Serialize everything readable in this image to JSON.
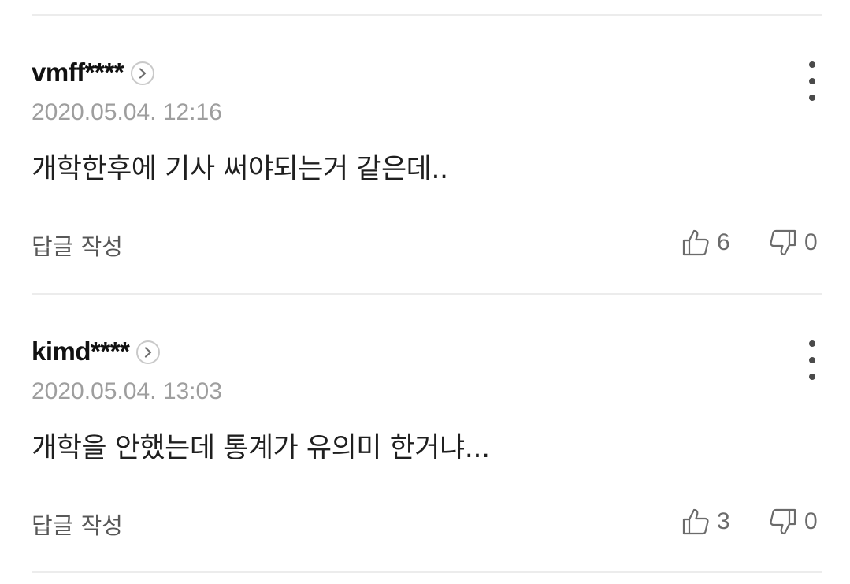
{
  "comments": [
    {
      "author": "vmff****",
      "timestamp": "2020.05.04. 12:16",
      "body": "개학한후에 기사 써야되는거 같은데..",
      "reply_label": "답글 작성",
      "likes": "6",
      "dislikes": "0"
    },
    {
      "author": "kimd****",
      "timestamp": "2020.05.04. 13:03",
      "body": "개학을 안했는데 통계가 유의미 한거냐...",
      "reply_label": "답글 작성",
      "likes": "3",
      "dislikes": "0"
    }
  ],
  "icons": {
    "profile_link": "chevron-right-circle-icon",
    "more": "vertical-ellipsis-icon",
    "like": "thumbs-up-icon",
    "dislike": "thumbs-down-icon"
  },
  "colors": {
    "author": "#111111",
    "timestamp": "#9e9e9e",
    "body": "#1f1f1f",
    "secondary": "#585858",
    "divider": "#ececec"
  }
}
